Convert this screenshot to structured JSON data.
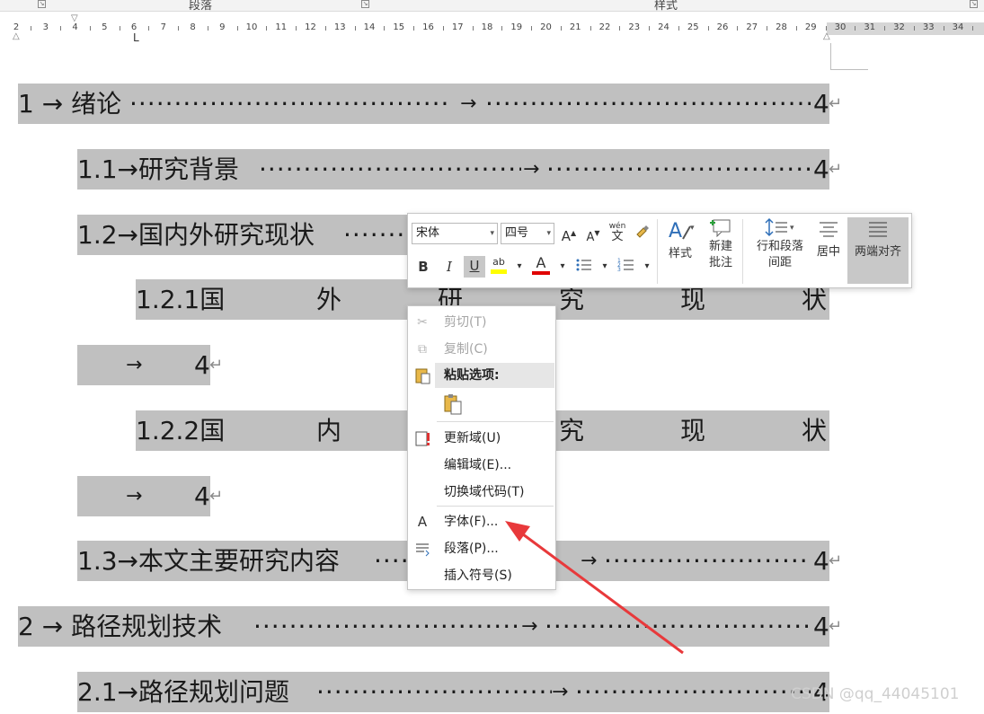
{
  "ribbon": {
    "group_paragraph": "段落",
    "group_styles": "样式"
  },
  "ruler": {
    "numbers": [
      "2",
      "3",
      "4",
      "5",
      "6",
      "7",
      "8",
      "9",
      "10",
      "11",
      "12",
      "13",
      "14",
      "15",
      "16",
      "17",
      "18",
      "19",
      "20",
      "21",
      "22",
      "23",
      "24",
      "25",
      "26",
      "27",
      "28",
      "29",
      "30",
      "31",
      "32",
      "33",
      "34",
      "3"
    ]
  },
  "toc": [
    {
      "text": "1 → 绪论",
      "page": "4"
    },
    {
      "text": "1.1→研究背景",
      "page": "4"
    },
    {
      "text": "1.2→国内外研究现状",
      "page": "4"
    },
    {
      "text": "1.2.1国",
      "page": ""
    },
    {
      "text": "→",
      "page": "4"
    },
    {
      "text": "1.2.2国",
      "page": ""
    },
    {
      "text": "→",
      "page": "4"
    },
    {
      "text": "1.3→本文主要研究内容",
      "page": "4"
    },
    {
      "text": "2 → 路径规划技术",
      "page": "4"
    },
    {
      "text": "2.1→路径规划问题",
      "page": "4"
    }
  ],
  "toc_extra": {
    "l4_words": [
      "外",
      "研",
      "究",
      "现",
      "状"
    ],
    "l6_words": [
      "内",
      "究",
      "现",
      "状"
    ]
  },
  "mini_toolbar": {
    "font_name": "宋体",
    "font_size": "四号",
    "grow_font": "A",
    "shrink_font": "A",
    "phonetic_top": "wén",
    "phonetic_bottom": "文",
    "bold": "B",
    "italic": "I",
    "underline": "U",
    "highlight": "ab",
    "font_color": "A",
    "styles": "样式",
    "new_comment_1": "新建",
    "new_comment_2": "批注",
    "line_spacing_1": "行和段落",
    "line_spacing_2": "间距",
    "center": "居中",
    "justify": "两端对齐"
  },
  "context_menu": {
    "cut": "剪切(T)",
    "copy": "复制(C)",
    "paste_options": "粘贴选项:",
    "update_field": "更新域(U)",
    "edit_field": "编辑域(E)...",
    "toggle_field_codes": "切换域代码(T)",
    "font": "字体(F)...",
    "paragraph": "段落(P)...",
    "insert_symbol": "插入符号(S)"
  },
  "watermark": "CSDN @qq_44045101",
  "colors": {
    "field_shade": "#c0c0c0",
    "highlight_yellow": "#ffff00",
    "font_color_red": "#e00000",
    "annotation_arrow": "#e8393b",
    "toggle_active": "#c8c8c8"
  }
}
